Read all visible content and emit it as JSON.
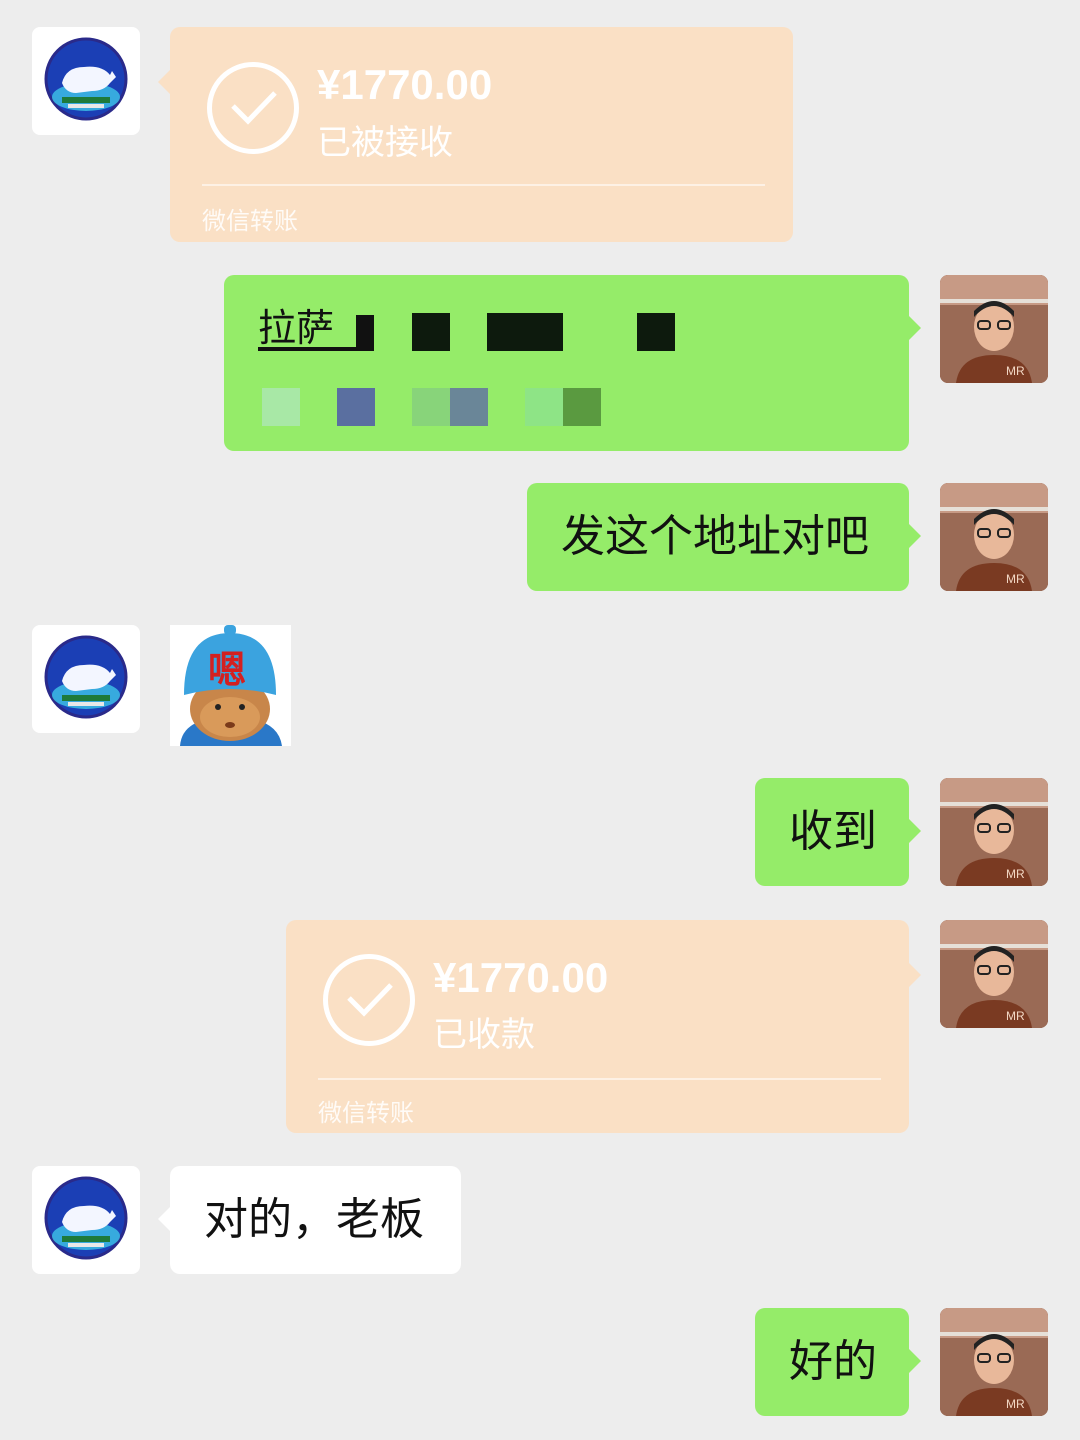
{
  "colors": {
    "background": "#ededed",
    "my_bubble": "#95ec69",
    "their_bubble": "#ffffff",
    "transfer_card": "#fae0c5"
  },
  "messages": [
    {
      "sender": "other",
      "type": "transfer",
      "amount": "¥1770.00",
      "status": "已被接收",
      "footer": "微信转账",
      "icon": "check-circle-icon"
    },
    {
      "sender": "me",
      "type": "text-redacted",
      "visible_text": "拉萨"
    },
    {
      "sender": "me",
      "type": "text",
      "text": "发这个地址对吧"
    },
    {
      "sender": "other",
      "type": "sticker",
      "sticker_text": "嗯"
    },
    {
      "sender": "me",
      "type": "text",
      "text": "收到"
    },
    {
      "sender": "me",
      "type": "transfer",
      "amount": "¥1770.00",
      "status": "已收款",
      "footer": "微信转账",
      "icon": "check-circle-icon"
    },
    {
      "sender": "other",
      "type": "text",
      "text": "对的，老板"
    },
    {
      "sender": "me",
      "type": "text",
      "text": "好的"
    }
  ]
}
